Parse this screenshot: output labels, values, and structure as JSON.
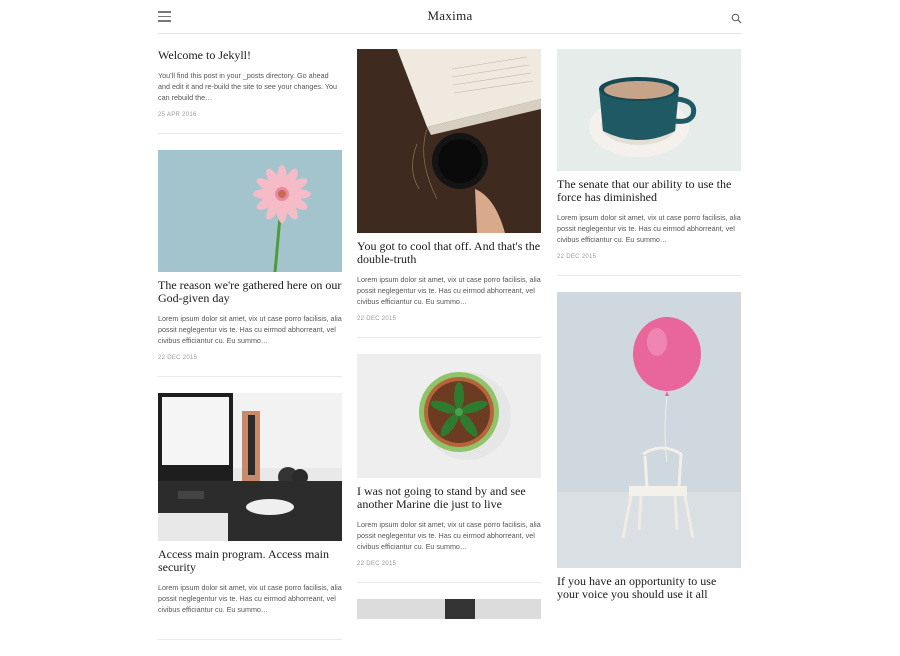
{
  "header": {
    "title": "Maxima",
    "menu_icon": "hamburger-menu-icon",
    "search_icon": "search-icon"
  },
  "posts": [
    {
      "title": "Welcome to Jekyll!",
      "excerpt": "You’ll find this post in your _posts directory. Go ahead and edit it and re-build the site to see your changes. You can rebuild the…",
      "date": "25 APR 2016"
    },
    {
      "title": "The reason we're gathered here on our God-given day",
      "excerpt": "Lorem ipsum dolor sit amet, vix ut case porro facilisis, alia possit neglegentur vis te. Has cu eirmod abhorreant, vel civibus efficiantur cu. Eu summo…",
      "date": "22 DEC 2015"
    },
    {
      "title": "Access main program. Access main security",
      "excerpt": "Lorem ipsum dolor sit amet, vix ut case porro facilisis, alia possit neglegentur vis te. Has cu eirmod abhorreant, vel civibus efficiantur cu. Eu summo…"
    },
    {
      "title": "You got to cool that off. And that's the double-truth",
      "excerpt": "Lorem ipsum dolor sit amet, vix ut case porro facilisis, alia possit neglegentur vis te. Has cu eirmod abhorreant, vel civibus efficiantur cu. Eu summo…",
      "date": "22 DEC 2015"
    },
    {
      "title": "I was not going to stand by and see another Marine die just to live",
      "excerpt": "Lorem ipsum dolor sit amet, vix ut case porro facilisis, alia possit neglegentur vis te. Has cu eirmod abhorreant, vel civibus efficiantur cu. Eu summo…",
      "date": "22 DEC 2015"
    },
    {
      "title": "The senate that our ability to use the force has diminished",
      "excerpt": "Lorem ipsum dolor sit amet, vix ut case porro facilisis, alia possit neglegentur vis te. Has cu eirmod abhorreant, vel civibus efficiantur cu. Eu summo…",
      "date": "22 DEC 2015"
    },
    {
      "title": "If you have an opportunity to use your voice you should use it all"
    }
  ],
  "colors": {
    "flower_bg": "#9fc1c9",
    "flower_petal": "#f4b6c2",
    "wood": "#4a3428",
    "cup_teal": "#1f5a64",
    "balloon_pink": "#e8669a",
    "plant_green": "#3a8a3a"
  }
}
